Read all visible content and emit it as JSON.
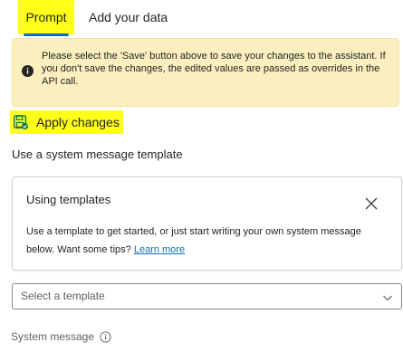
{
  "tabs": {
    "prompt": "Prompt",
    "add_data": "Add your data"
  },
  "banner": {
    "message": "Please select the 'Save' button above to save your changes to the assistant. If you don't save the changes, the edited values are passed as overrides in the API call."
  },
  "apply_changes": {
    "label": "Apply changes"
  },
  "template_section": {
    "title": "Use a system message template"
  },
  "template_card": {
    "title": "Using templates",
    "body_text": "Use a template to get started, or just start writing your own system message below. Want some tips? ",
    "link_text": "Learn more"
  },
  "template_select": {
    "placeholder": "Select a template"
  },
  "system_message": {
    "label": "System message"
  },
  "colors": {
    "highlight": "#ffff1a",
    "banner_bg": "#fbefbf",
    "accent": "#0f6cbd",
    "save_icon": "#107c41"
  },
  "icons": {
    "banner": "info-filled-icon",
    "apply": "save-icon",
    "close": "close-icon",
    "select": "chevron-down-icon",
    "system_message": "info-icon"
  }
}
